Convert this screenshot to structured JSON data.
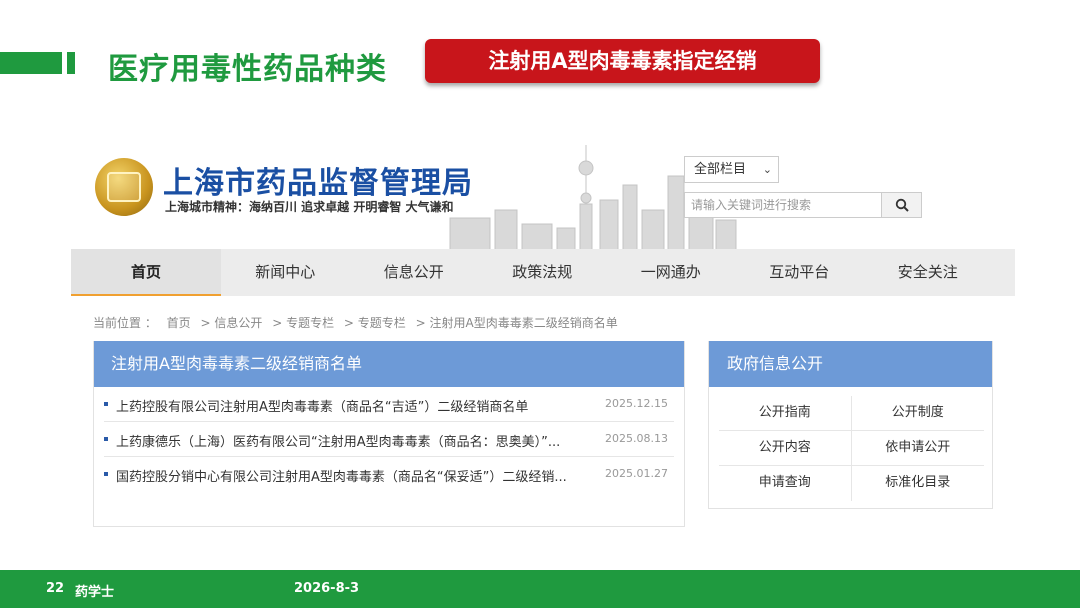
{
  "slide": {
    "title": "医疗用毒性药品种类",
    "banner": "注射用A型肉毒毒素指定经销",
    "footer": {
      "page": "22",
      "brand": "药学士",
      "date": "2026-8-3"
    },
    "colors": {
      "brand_green": "#1f9a3f",
      "banner_red": "#c8151b"
    }
  },
  "site": {
    "name": "上海市药品监督管理局",
    "motto": "上海城市精神：海纳百川  追求卓越  开明睿智  大气谦和",
    "logo_icon": "emblem-icon",
    "colors": {
      "site_blue": "#1a4fa3",
      "panel_blue": "#6d9ad7"
    }
  },
  "search": {
    "scope": "全部栏目",
    "placeholder": "请输入关键词进行搜索",
    "button_icon": "search-icon"
  },
  "nav": {
    "items": [
      "首页",
      "新闻中心",
      "信息公开",
      "政策法规",
      "一网通办",
      "互动平台",
      "安全关注"
    ],
    "active": "首页"
  },
  "breadcrumb": {
    "label": "当前位置 ：",
    "items": [
      "首页",
      "> 信息公开",
      "> 专题专栏",
      "> 专题专栏",
      "> 注射用A型肉毒毒素二级经销商名单"
    ]
  },
  "list_panel": {
    "title": "注射用A型肉毒毒素二级经销商名单",
    "items": [
      {
        "title": "上药控股有限公司注射用A型肉毒毒素（商品名“吉适”）二级经销商名单",
        "date": "2025.12.15"
      },
      {
        "title": "上药康德乐（上海）医药有限公司“注射用A型肉毒毒素（商品名：思奥美）”...",
        "date": "2025.08.13"
      },
      {
        "title": "国药控股分销中心有限公司注射用A型肉毒毒素（商品名“保妥适”）二级经销...",
        "date": "2025.01.27"
      }
    ]
  },
  "gov_panel": {
    "title": "政府信息公开",
    "links": [
      [
        "公开指南",
        "公开制度"
      ],
      [
        "公开内容",
        "依申请公开"
      ],
      [
        "申请查询",
        "标准化目录"
      ]
    ]
  }
}
